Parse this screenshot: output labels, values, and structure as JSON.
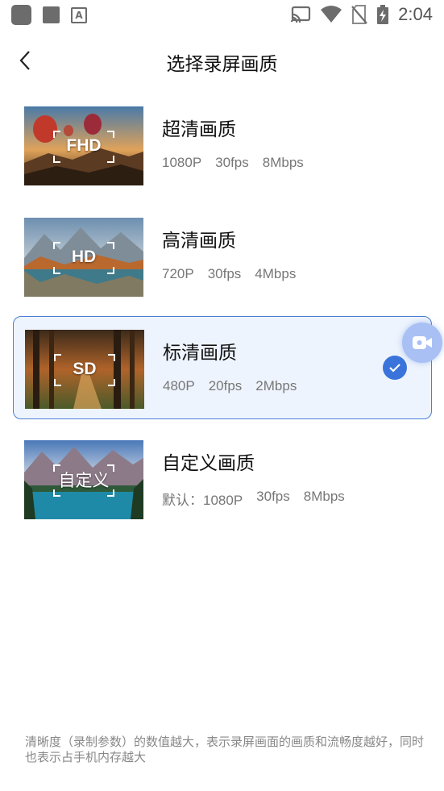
{
  "status_bar": {
    "time": "2:04",
    "left_icons": [
      "app-square-icon",
      "app-square-icon",
      "font-a-icon"
    ],
    "right_icons": [
      "cast-icon",
      "wifi-icon",
      "no-sim-icon",
      "battery-charging-icon"
    ]
  },
  "header": {
    "title": "选择录屏画质",
    "back_icon": "chevron-left-icon"
  },
  "options": [
    {
      "thumb_label": "FHD",
      "name": "超清画质",
      "specs": [
        "1080P",
        "30fps",
        "8Mbps"
      ],
      "selected": false
    },
    {
      "thumb_label": "HD",
      "name": "高清画质",
      "specs": [
        "720P",
        "30fps",
        "4Mbps"
      ],
      "selected": false
    },
    {
      "thumb_label": "SD",
      "name": "标清画质",
      "specs": [
        "480P",
        "20fps",
        "2Mbps"
      ],
      "selected": true
    },
    {
      "thumb_label": "自定义",
      "name": "自定义画质",
      "specs": [
        "默认：1080P",
        "30fps",
        "8Mbps"
      ],
      "selected": false
    }
  ],
  "footnote": "清晰度（录制参数）的数值越大，表示录屏画面的画质和流畅度越好，同时也表示占手机内存越大",
  "colors": {
    "accent": "#3a74db",
    "selected_bg": "#eef4fd",
    "secondary_text": "#777777"
  }
}
